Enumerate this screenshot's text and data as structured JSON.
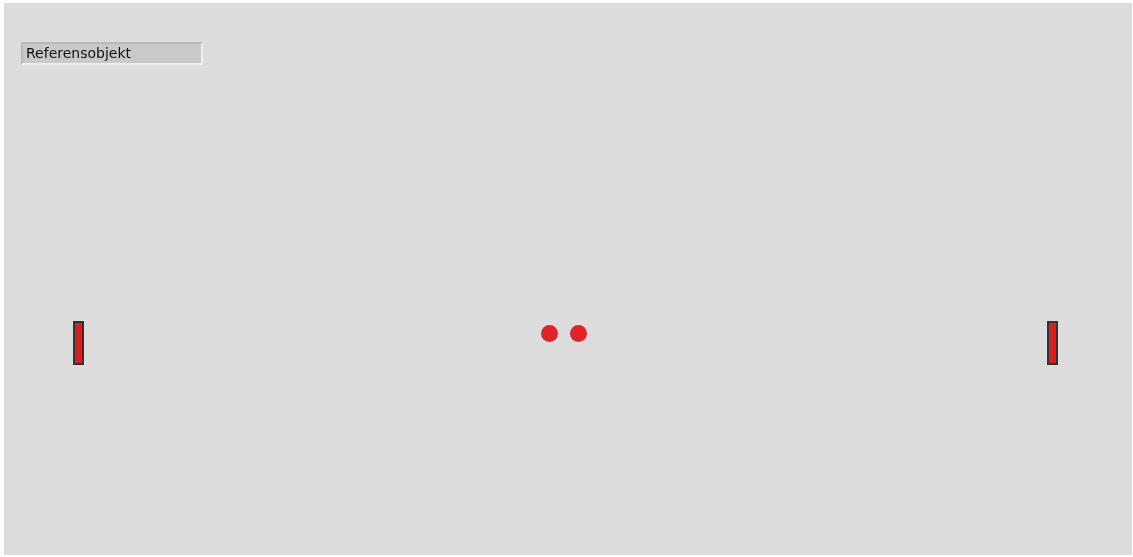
{
  "reference_field": {
    "value": "Referensobjekt"
  }
}
